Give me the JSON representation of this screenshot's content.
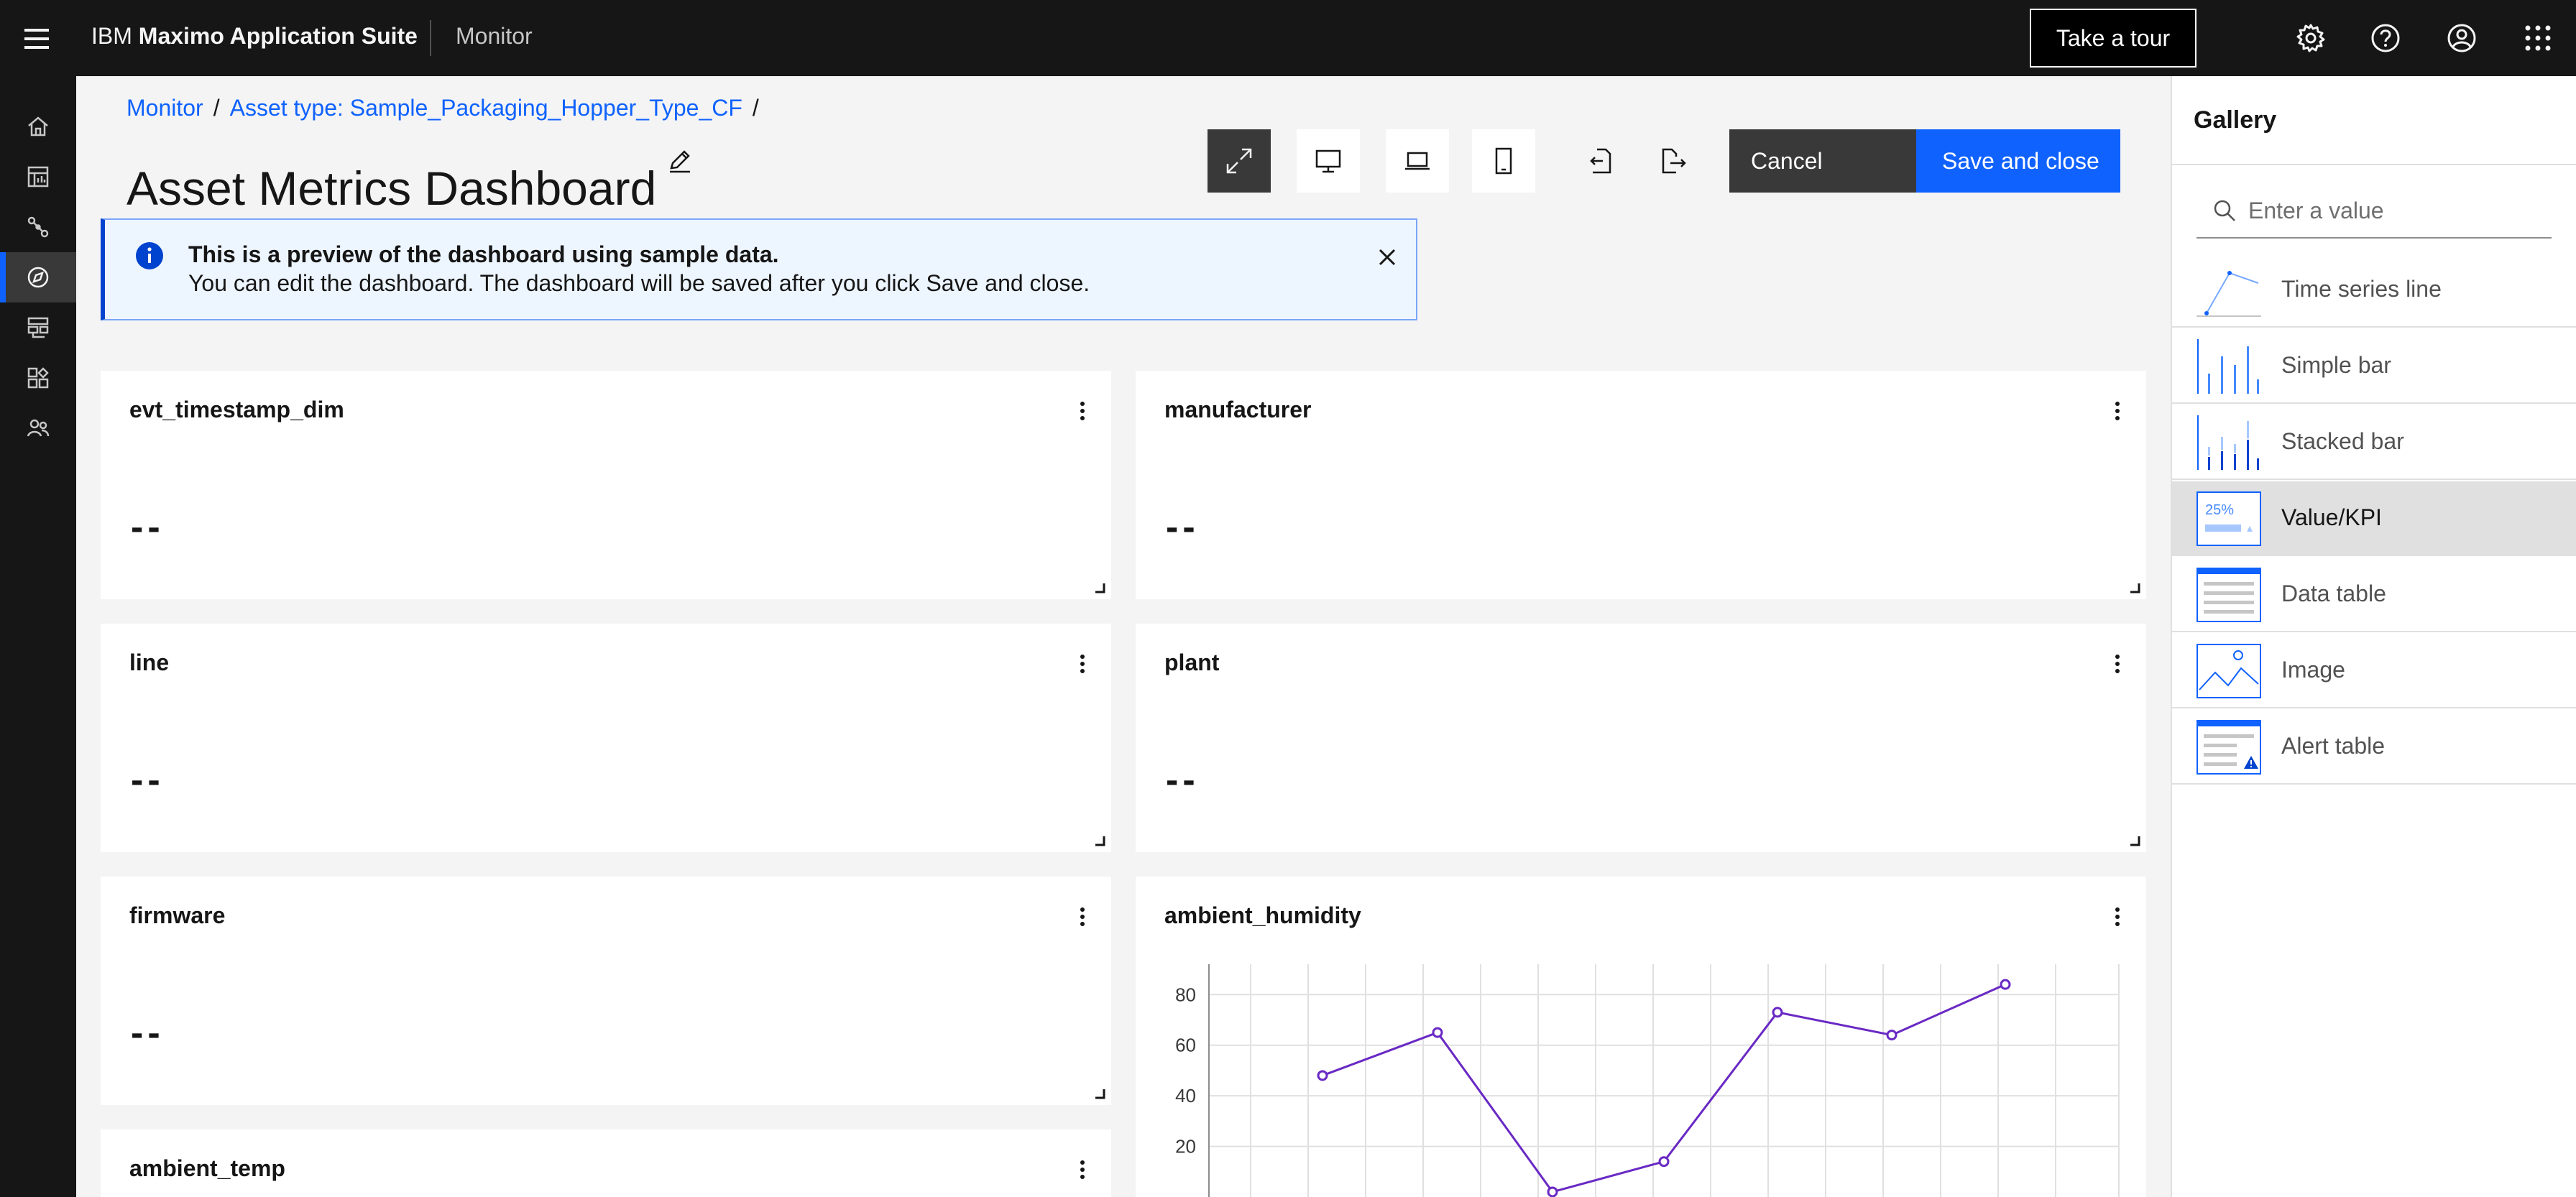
{
  "header": {
    "brand_prefix": "IBM",
    "brand_name": "Maximo Application Suite",
    "app_name": "Monitor",
    "tour_label": "Take a tour"
  },
  "breadcrumb": {
    "item1": "Monitor",
    "item2": "Asset type: Sample_Packaging_Hopper_Type_CF",
    "separator": "/"
  },
  "page": {
    "title": "Asset Metrics Dashboard"
  },
  "toolbar": {
    "cancel_label": "Cancel",
    "save_label": "Save and close"
  },
  "notification": {
    "title": "This is a preview of the dashboard using sample data.",
    "subtitle": "You can edit the dashboard. The dashboard will be saved after you click Save and close."
  },
  "cards": [
    {
      "title": "evt_timestamp_dim",
      "value": "--"
    },
    {
      "title": "manufacturer",
      "value": "--"
    },
    {
      "title": "line",
      "value": "--"
    },
    {
      "title": "plant",
      "value": "--"
    },
    {
      "title": "firmware",
      "value": "--"
    },
    {
      "title": "ambient_humidity"
    },
    {
      "title": "ambient_temp"
    }
  ],
  "chart_data": {
    "type": "line",
    "title": "ambient_humidity",
    "yticks": [
      "80",
      "60",
      "40",
      "20"
    ],
    "ylim": [
      0,
      92
    ],
    "values": [
      48,
      65,
      2,
      14,
      73,
      64,
      84
    ],
    "grid": true,
    "color": "#6929c4"
  },
  "gallery": {
    "title": "Gallery",
    "search_placeholder": "Enter a value",
    "items": [
      {
        "label": "Time series line",
        "icon": "time-series-line-icon"
      },
      {
        "label": "Simple bar",
        "icon": "simple-bar-icon"
      },
      {
        "label": "Stacked bar",
        "icon": "stacked-bar-icon"
      },
      {
        "label": "Value/KPI",
        "icon": "value-kpi-icon",
        "thumb_text": "25%"
      },
      {
        "label": "Data table",
        "icon": "data-table-icon"
      },
      {
        "label": "Image",
        "icon": "image-icon"
      },
      {
        "label": "Alert table",
        "icon": "alert-table-icon"
      }
    ]
  },
  "colors": {
    "accent": "#0f62fe",
    "header_bg": "#161616",
    "info_border": "#0043ce",
    "chart_line": "#6929c4"
  }
}
